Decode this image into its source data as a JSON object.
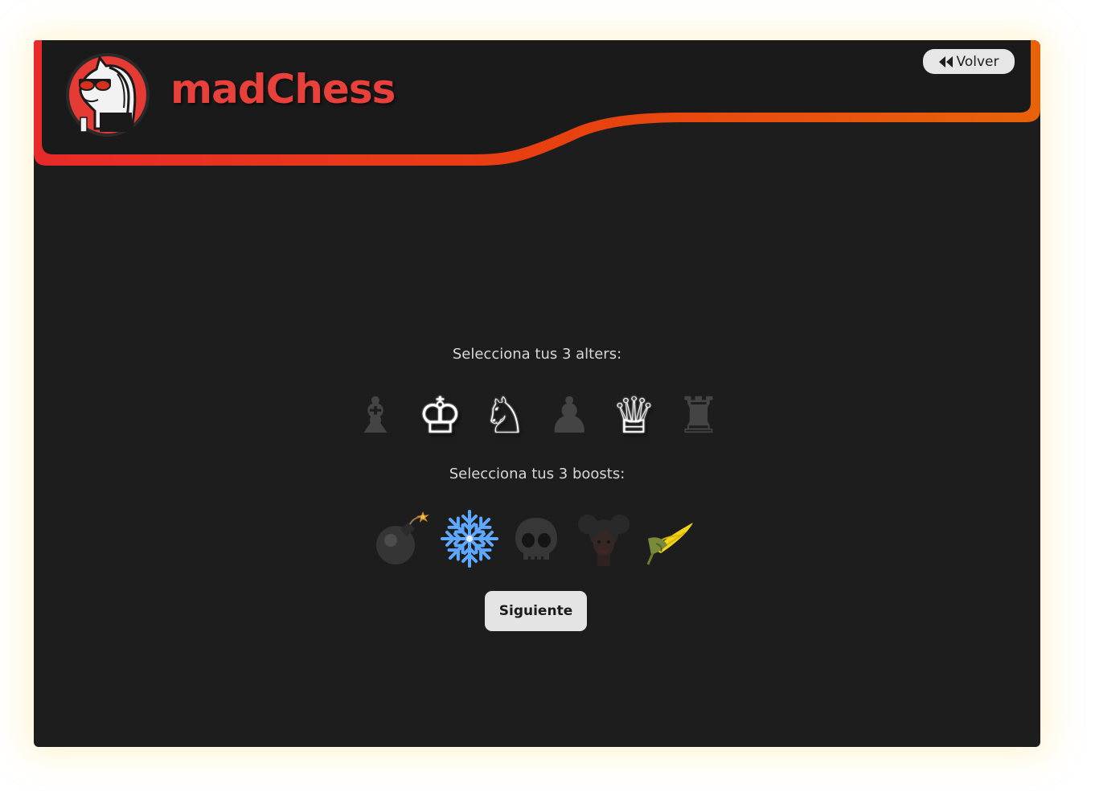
{
  "header": {
    "brand": "madChess",
    "back_label": "Volver",
    "accent_red": "#e8302a",
    "accent_orange": "#e8580e"
  },
  "alters": {
    "prompt": "Selecciona tus 3 alters:",
    "pieces": [
      {
        "name": "bishop",
        "glyph": "♝",
        "selected": false
      },
      {
        "name": "king",
        "glyph": "♔",
        "selected": true
      },
      {
        "name": "knight",
        "glyph": "♘",
        "selected": true
      },
      {
        "name": "pawn",
        "glyph": "♟",
        "selected": false
      },
      {
        "name": "queen",
        "glyph": "♕",
        "selected": true
      },
      {
        "name": "rook",
        "glyph": "♜",
        "selected": false
      }
    ]
  },
  "boosts": {
    "prompt": "Selecciona tus 3 boosts:",
    "items": [
      {
        "icon": "bomb-icon",
        "selected": false
      },
      {
        "icon": "snowflake-icon",
        "selected": true
      },
      {
        "icon": "skull-icon",
        "selected": false
      },
      {
        "icon": "woman-icon",
        "selected": false
      },
      {
        "icon": "corn-icon",
        "selected": true
      }
    ]
  },
  "actions": {
    "next_label": "Siguiente"
  },
  "colors": {
    "background": "#1d1d1d",
    "glow": "#ffe28c",
    "button_bg": "#e4e4e4"
  }
}
